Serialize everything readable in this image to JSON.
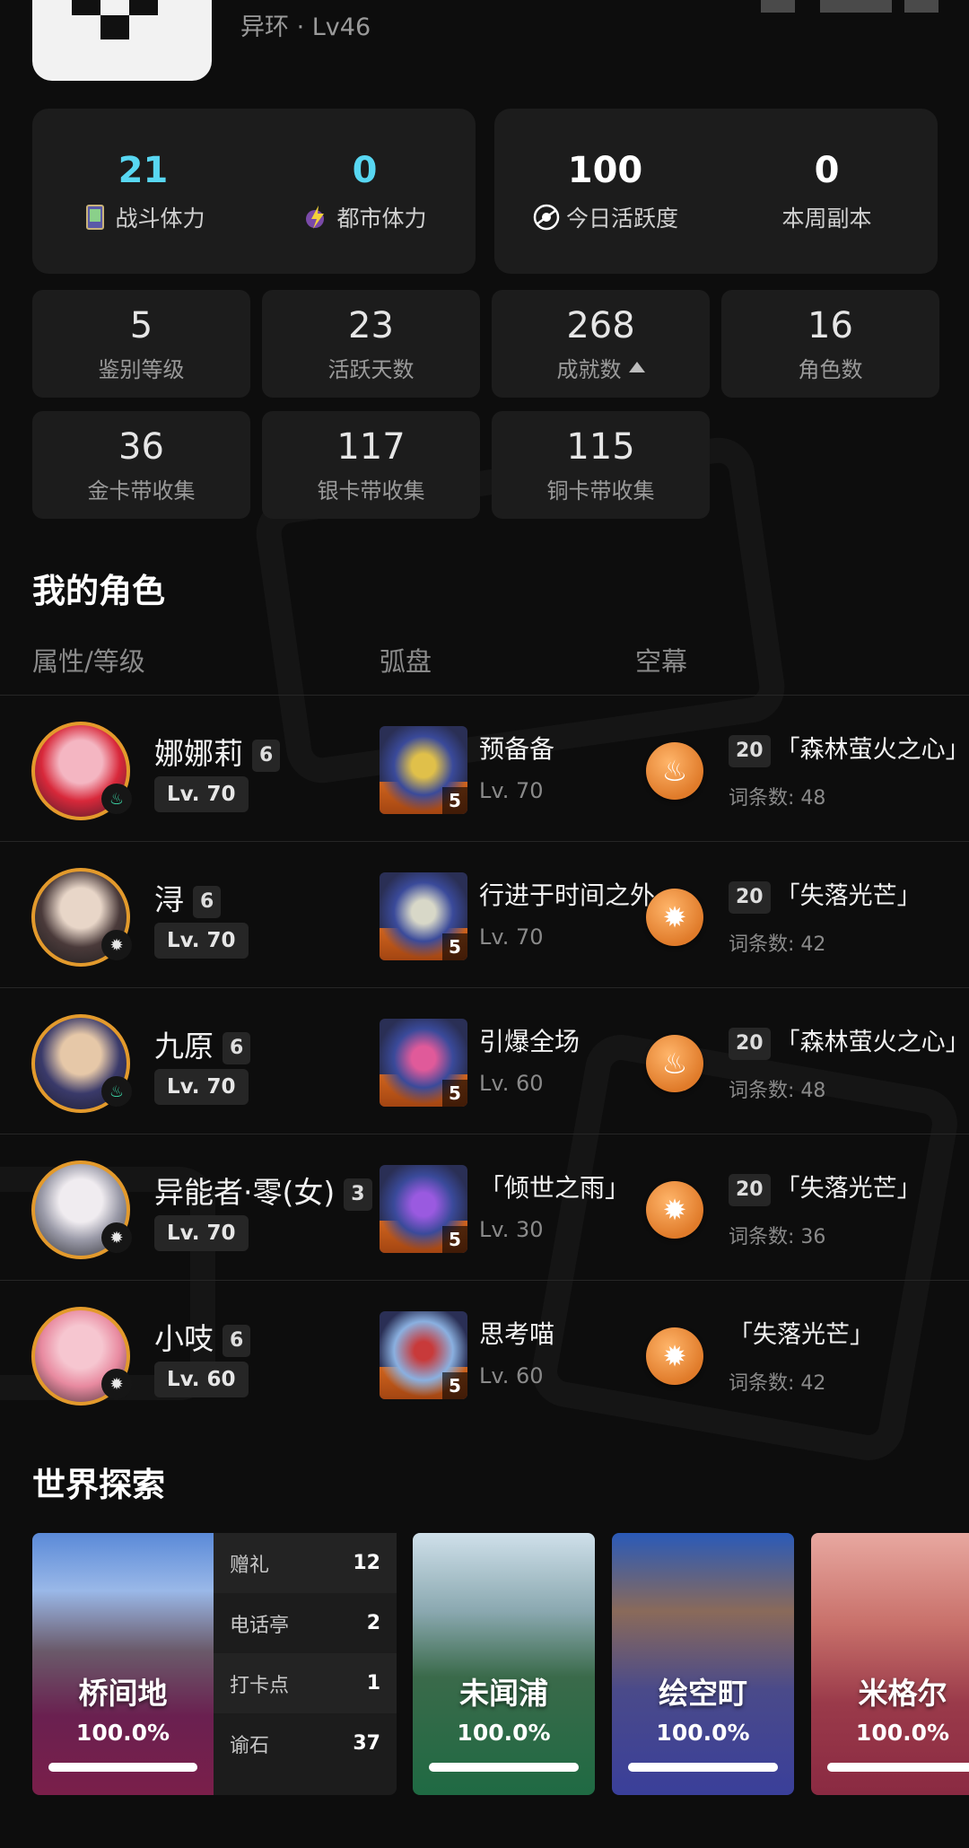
{
  "profile": {
    "subtitle": "异环 · Lv46"
  },
  "top_panels": [
    {
      "value": "21",
      "label": "战斗体力",
      "icon": "card-icon"
    },
    {
      "value": "0",
      "label": "都市体力",
      "icon": "lightning-icon"
    },
    {
      "value": "100",
      "label": "今日活跃度",
      "icon": "eye-icon"
    },
    {
      "value": "0",
      "label": "本周副本"
    }
  ],
  "stats": [
    {
      "value": "5",
      "label": "鉴别等级"
    },
    {
      "value": "23",
      "label": "活跃天数"
    },
    {
      "value": "268",
      "label": "成就数"
    },
    {
      "value": "16",
      "label": "角色数"
    },
    {
      "value": "36",
      "label": "金卡带收集"
    },
    {
      "value": "117",
      "label": "银卡带收集"
    },
    {
      "value": "115",
      "label": "铜卡带收集"
    }
  ],
  "characters_section": {
    "title": "我的角色",
    "col_attr": "属性/等级",
    "col_disk": "弧盘",
    "col_sky": "空幕"
  },
  "characters": [
    {
      "name": "娜娜莉",
      "rank": "6",
      "level": "Lv. 70",
      "element": "flame-icon",
      "disk_name": "预备备",
      "disk_level": "Lv. 70",
      "disk_num": "5",
      "sky_level": "20",
      "sky_name": "「森林萤火之心」",
      "entries": "词条数: 48",
      "coin": "flame-icon"
    },
    {
      "name": "浔",
      "rank": "6",
      "level": "Lv. 70",
      "element": "sun-icon",
      "disk_name": "行进于时间之外",
      "disk_level": "Lv. 70",
      "disk_num": "5",
      "sky_level": "20",
      "sky_name": "「失落光芒」",
      "entries": "词条数: 42",
      "coin": "sun-icon"
    },
    {
      "name": "九原",
      "rank": "6",
      "level": "Lv. 70",
      "element": "flame-icon",
      "disk_name": "引爆全场",
      "disk_level": "Lv. 60",
      "disk_num": "5",
      "sky_level": "20",
      "sky_name": "「森林萤火之心」",
      "entries": "词条数: 48",
      "coin": "flame-icon"
    },
    {
      "name": "异能者·零(女)",
      "rank": "3",
      "level": "Lv. 70",
      "element": "sun-icon",
      "disk_name": "「倾世之雨」",
      "disk_level": "Lv. 30",
      "disk_num": "5",
      "sky_level": "20",
      "sky_name": "「失落光芒」",
      "entries": "词条数: 36",
      "coin": "sun-icon"
    },
    {
      "name": "小吱",
      "rank": "6",
      "level": "Lv. 60",
      "element": "sun-icon",
      "disk_name": "思考喵",
      "disk_level": "Lv. 60",
      "disk_num": "5",
      "sky_level": "",
      "sky_name": "「失落光芒」",
      "entries": "词条数: 42",
      "coin": "sun-icon"
    }
  ],
  "explore_section": {
    "title": "世界探索"
  },
  "explore": [
    {
      "name": "桥间地",
      "percent": "100.0%",
      "progress": 1.0,
      "color": "#7a1f4a"
    },
    {
      "name": "未闻浦",
      "percent": "100.0%",
      "progress": 1.0,
      "color": "#1f6a43"
    },
    {
      "name": "绘空町",
      "percent": "100.0%",
      "progress": 1.0,
      "color": "#3a3f9a"
    },
    {
      "name": "米格尔",
      "percent": "100.0%",
      "progress": 1.0,
      "color": "#8a2a42"
    }
  ],
  "explore_details": [
    {
      "label": "赠礼",
      "value": "12"
    },
    {
      "label": "电话亭",
      "value": "2"
    },
    {
      "label": "打卡点",
      "value": "1"
    },
    {
      "label": "谕石",
      "value": "37"
    }
  ]
}
